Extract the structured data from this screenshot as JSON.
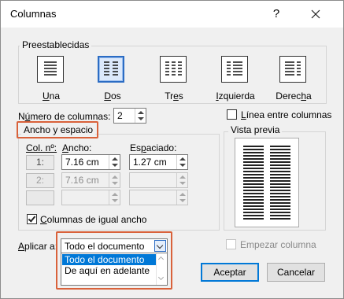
{
  "window": {
    "title": "Columnas",
    "help": "?"
  },
  "presets": {
    "group_label": "Preestablecidas",
    "items": [
      {
        "key": "U",
        "rest": "na",
        "icon": "one-column-icon"
      },
      {
        "key": "D",
        "rest": "os",
        "icon": "two-columns-icon",
        "selected": true
      },
      {
        "key": "",
        "pre": "Tr",
        "keymid": "e",
        "rest": "s",
        "icon": "three-columns-icon"
      },
      {
        "key": "I",
        "rest": "zquierda",
        "icon": "left-column-icon"
      },
      {
        "key": "",
        "pre": "Derec",
        "keymid": "h",
        "rest": "a",
        "icon": "right-column-icon"
      }
    ]
  },
  "num_columns": {
    "label_pre": "N",
    "label_key": "ú",
    "label_rest": "mero de columnas:",
    "value": "2"
  },
  "line_between": {
    "key": "L",
    "rest": "ínea entre columnas",
    "checked": false
  },
  "width_spacing": {
    "group_label": "Ancho y espacio",
    "col_header": "Col. nº:",
    "width_header_key": "A",
    "width_header_rest": "ncho:",
    "spacing_header_pre": "Es",
    "spacing_header_key": "p",
    "spacing_header_rest": "aciado:",
    "rows": [
      {
        "col": "1:",
        "width": "7.16 cm",
        "spacing": "1.27 cm",
        "enabled": true
      },
      {
        "col": "2:",
        "width": "7.16 cm",
        "spacing": "",
        "enabled": false
      },
      {
        "col": "",
        "width": "",
        "spacing": "",
        "enabled": false
      }
    ],
    "equal_width": {
      "key": "C",
      "rest": "olumnas de igual ancho",
      "checked": true
    }
  },
  "preview": {
    "label": "Vista previa"
  },
  "apply_to": {
    "label_key": "A",
    "label_rest": "plicar a:",
    "value": "Todo el documento",
    "options": [
      "Todo el documento",
      "De aquí en adelante"
    ]
  },
  "start_column": {
    "label": "Empezar columna",
    "checked": false
  },
  "buttons": {
    "ok": "Aceptar",
    "cancel": "Cancelar"
  },
  "colors": {
    "highlight": "#d9623b",
    "accent": "#0078d7"
  }
}
